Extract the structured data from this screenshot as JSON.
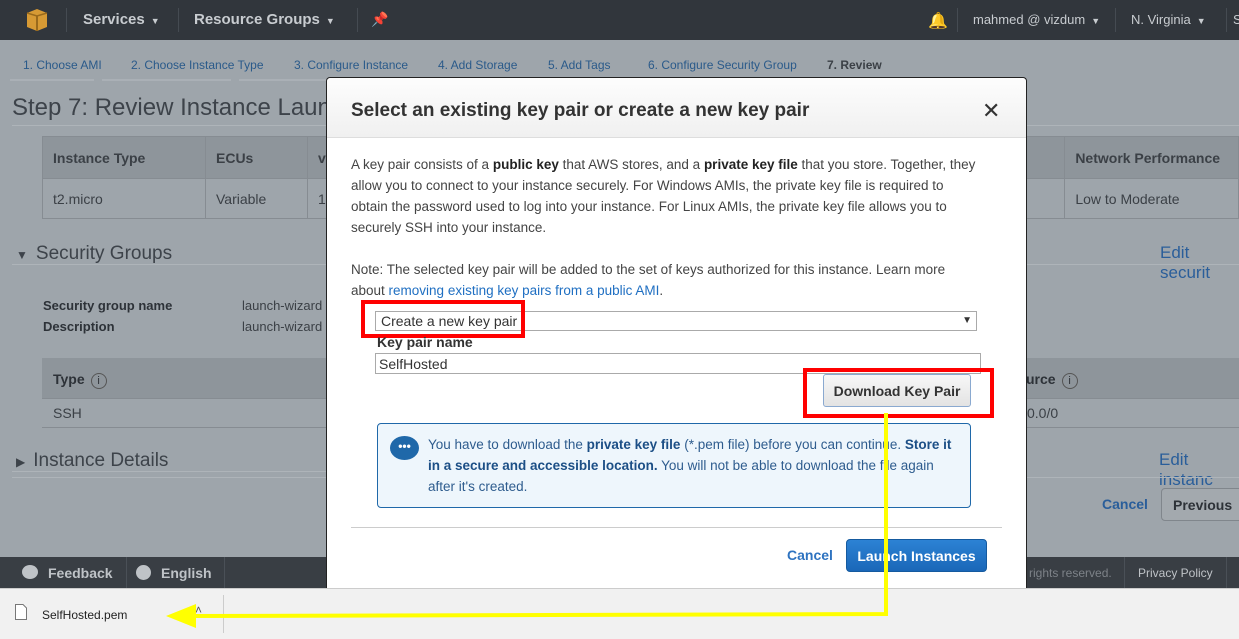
{
  "nav": {
    "services": "Services",
    "resource_groups": "Resource Groups",
    "user": "mahmed @ vizdum",
    "region": "N. Virginia",
    "support_partial": "S"
  },
  "steps": [
    "1. Choose AMI",
    "2. Choose Instance Type",
    "3. Configure Instance",
    "4. Add Storage",
    "5. Add Tags",
    "6. Configure Security Group",
    "7. Review"
  ],
  "page": {
    "title": "Step 7: Review Instance Laun",
    "instance_table": {
      "headers": [
        "Instance Type",
        "ECUs",
        "v"
      ],
      "row": [
        "t2.micro",
        "Variable",
        "1"
      ],
      "right_header": "Network Performance",
      "right_value": "Low to Moderate"
    },
    "security_groups": {
      "title": "Security Groups",
      "edit_link": "Edit securit",
      "name_label": "Security group name",
      "name_value": "launch-wizard",
      "desc_label": "Description",
      "desc_value": "launch-wizard",
      "type_header": "Type",
      "type_value": "SSH",
      "source_header": "urce",
      "source_value": "0.0/0"
    },
    "instance_details": {
      "title": "Instance Details",
      "edit_link": "Edit instanc"
    },
    "cancel": "Cancel",
    "previous": "Previous"
  },
  "footer": {
    "feedback": "Feedback",
    "english": "English",
    "rights": "rights reserved.",
    "privacy": "Privacy Policy"
  },
  "modal": {
    "title": "Select an existing key pair or create a new key pair",
    "p1": [
      "A key pair consists of a ",
      "public key",
      " that AWS stores, and a ",
      "private key file",
      " that you store. Together, they allow you to connect to your instance securely. For Windows AMIs, the private key file is required to obtain the password used to log into your instance. For Linux AMIs, the private key file allows you to securely SSH into your instance."
    ],
    "p2": "Note: The selected key pair will be added to the set of keys authorized for this instance. Learn more about ",
    "p2_link": "removing existing key pairs from a public AMI",
    "p2_end": ".",
    "select_value": "Create a new key pair",
    "keypair_label": "Key pair name",
    "keypair_value": "SelfHosted",
    "download_button": "Download Key Pair",
    "alert": [
      "You have to download the ",
      "private key file",
      " (*.pem file) before you can continue. ",
      "Store it in a secure and accessible location.",
      " You will not be able to download the file again after it's created."
    ],
    "cancel": "Cancel",
    "launch": "Launch Instances"
  },
  "download_bar": {
    "filename": "SelfHosted.pem"
  },
  "colors": {
    "highlight": "#ff0000",
    "arrow": "#ffff00",
    "primary": "#1f6fc2"
  }
}
